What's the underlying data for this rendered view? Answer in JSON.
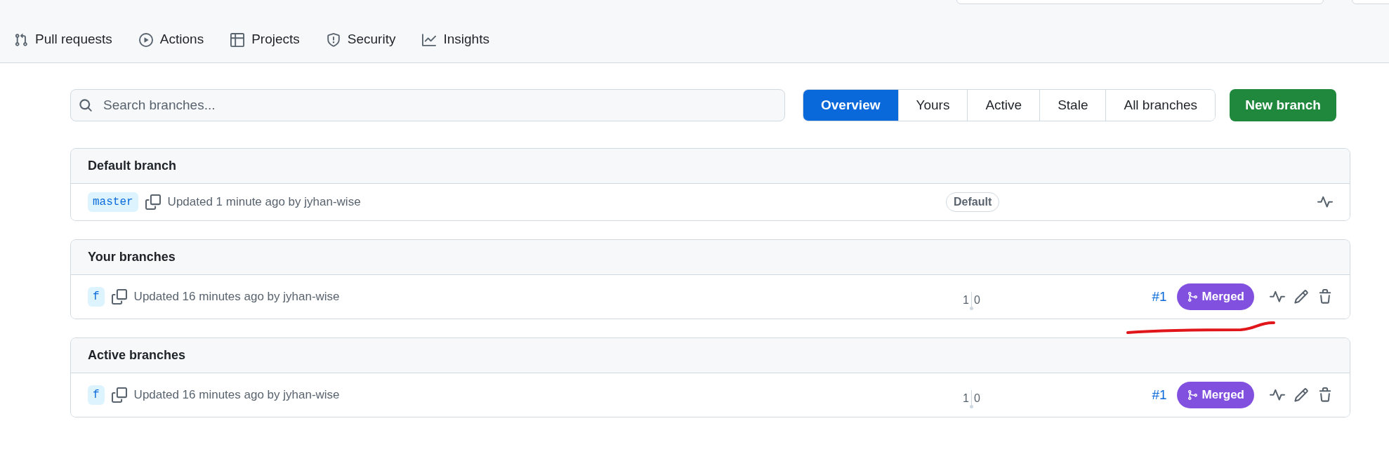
{
  "repo_nav": [
    {
      "label": "Pull requests"
    },
    {
      "label": "Actions"
    },
    {
      "label": "Projects"
    },
    {
      "label": "Security"
    },
    {
      "label": "Insights"
    }
  ],
  "search": {
    "placeholder": "Search branches..."
  },
  "tabs": [
    {
      "label": "Overview",
      "selected": true
    },
    {
      "label": "Yours",
      "selected": false
    },
    {
      "label": "Active",
      "selected": false
    },
    {
      "label": "Stale",
      "selected": false
    },
    {
      "label": "All branches",
      "selected": false
    }
  ],
  "new_branch_button": "New branch",
  "sections": [
    {
      "title": "Default branch",
      "branches": [
        {
          "name": "master",
          "updated": "Updated 1 minute ago by jyhan-wise",
          "badge": "Default",
          "kind": "default"
        }
      ]
    },
    {
      "title": "Your branches",
      "branches": [
        {
          "name": "f",
          "updated": "Updated 16 minutes ago by jyhan-wise",
          "behind": "1",
          "ahead": "0",
          "pr_number": "#1",
          "pr_status": "Merged",
          "kind": "editable"
        }
      ]
    },
    {
      "title": "Active branches",
      "branches": [
        {
          "name": "f",
          "updated": "Updated 16 minutes ago by jyhan-wise",
          "behind": "1",
          "ahead": "0",
          "pr_number": "#1",
          "pr_status": "Merged",
          "kind": "editable"
        }
      ]
    }
  ]
}
